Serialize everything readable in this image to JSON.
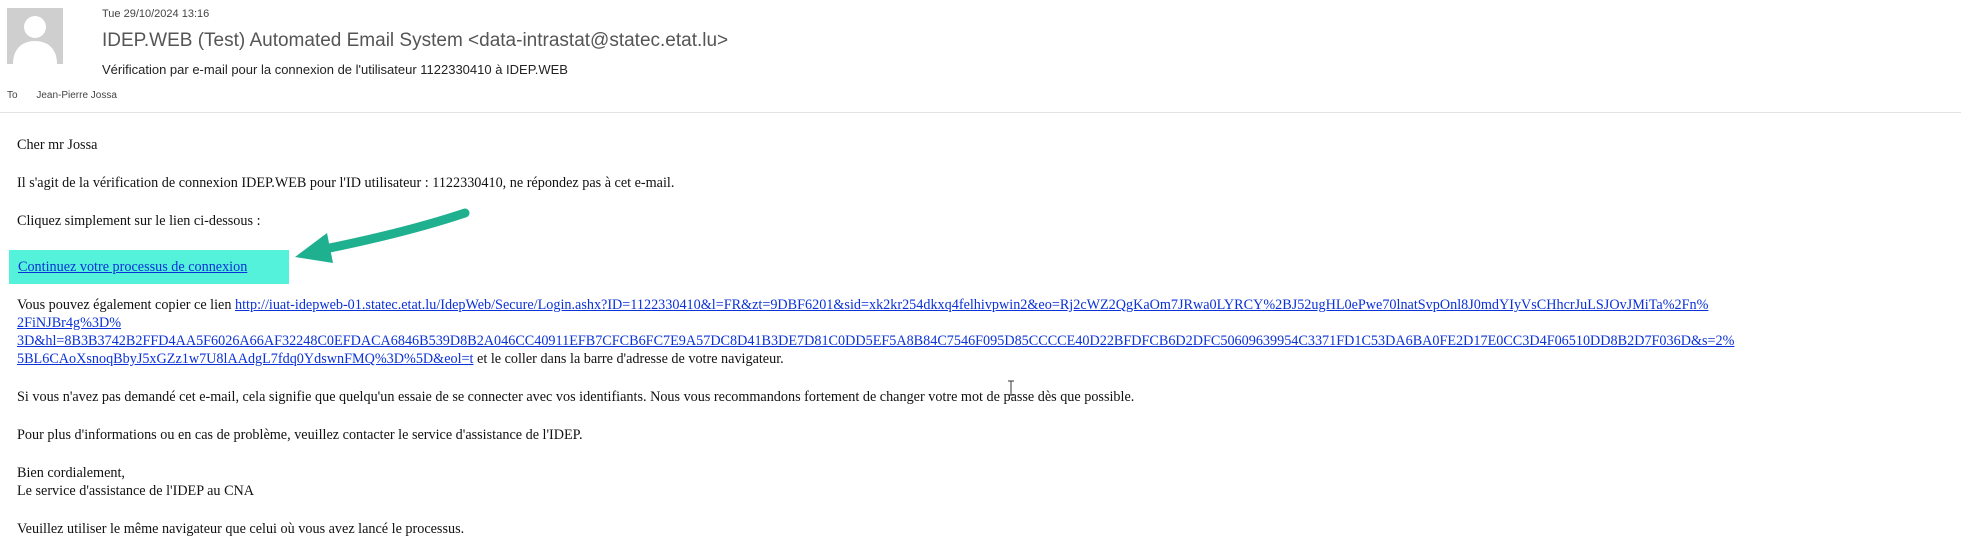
{
  "header": {
    "date": "Tue 29/10/2024 13:16",
    "from": "IDEP.WEB (Test) Automated Email System <data-intrastat@statec.etat.lu>",
    "subject": "Vérification par e-mail pour la connexion de l'utilisateur 1122330410 à IDEP.WEB",
    "to_label": "To",
    "to_name": "Jean-Pierre Jossa"
  },
  "body": {
    "greeting": "Cher mr Jossa",
    "intro": "Il s'agit de la vérification de connexion IDEP.WEB pour l'ID utilisateur : 1122330410, ne répondez pas à cet e-mail.",
    "click_instruction": "Cliquez simplement sur le lien ci-dessous :",
    "cta_link": "Continuez votre processus de connexion",
    "copy_prefix": "Vous pouvez également copier ce lien ",
    "copy_url_line1": "http://iuat-idepweb-01.statec.etat.lu/IdepWeb/Secure/Login.ashx?ID=1122330410&l=FR&zt=9DBF6201&sid=xk2kr254dkxq4felhivpwin2&eo=Rj2cWZ2QgKaOm7JRwa0LYRCY%2BJ52ugHL0ePwe70lnatSvpOnl8J0mdYIyVsCHhcrJuLSJOvJMiTa%2Fn%",
    "copy_url_line2": "2FiNJBr4g%3D%",
    "copy_url_line3": "3D&hl=8B3B3742B2FFD4AA5F6026A66AF32248C0EFDACA6846B539D8B2A046CC40911EFB7CFCB6FC7E9A57DC8D41B3DE7D81C0DD5EF5A8B84C7546F095D85CCCCE40D22BFDFCB6D2DFC50609639954C3371FD1C53DA6BA0FE2D17E0CC3D4F06510DD8B2D7F036D&s=2%",
    "copy_url_line4": "5BL6CAoXsnoqBbyJ5xGZz1w7U8lAAdgL7fdq0YdswnFMQ%3D%5D&eol=t",
    "copy_suffix": " et le coller dans la barre d'adresse de votre navigateur.",
    "warning": "Si vous n'avez pas demandé cet e-mail, cela signifie que quelqu'un essaie de se connecter avec vos identifiants. Nous vous recommandons fortement de changer votre mot de passe dès que possible.",
    "support": "Pour plus d'informations ou en cas de problème, veuillez contacter le service d'assistance de l'IDEP.",
    "closing": "Bien cordialement,",
    "signature": "Le service d'assistance de l'IDEP au CNA",
    "browser_note": "Veuillez utiliser le même navigateur que celui où vous avez lancé le processus."
  },
  "colors": {
    "highlight": "#54f2db",
    "arrow": "#1fb08f",
    "link": "#0b32d8"
  },
  "icons": {
    "avatar": "person-silhouette-icon",
    "annotation": "arrow-annotation-icon",
    "cursor": "text-cursor-icon"
  }
}
